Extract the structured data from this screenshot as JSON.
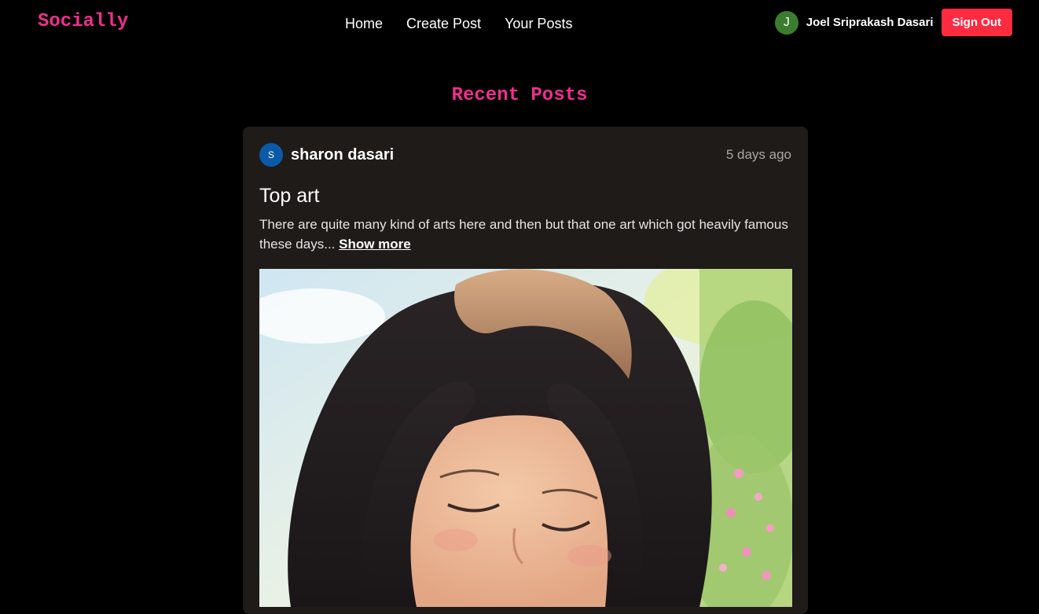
{
  "brand": "Socially",
  "nav": {
    "home": "Home",
    "create_post": "Create Post",
    "your_posts": "Your Posts"
  },
  "user": {
    "initial": "J",
    "name": "Joel Sriprakash Dasari",
    "sign_out": "Sign Out"
  },
  "section_title": "Recent Posts",
  "post": {
    "author_initial": "S",
    "author": "sharon dasari",
    "time": "5 days ago",
    "title": "Top art",
    "excerpt": "There are quite many kind of arts here and then but that one art which got heavily famous these days...",
    "show_more": "Show more",
    "image": "illustration of a girl with long dark hair and closed eyes, flowers and trees in background"
  },
  "colors": {
    "brand": "#ee2f8e",
    "sign_out_bg": "#ff2b41",
    "user_avatar": "#3a7d2e",
    "author_avatar": "#0b5aa8",
    "card_bg": "#1e1b19"
  }
}
